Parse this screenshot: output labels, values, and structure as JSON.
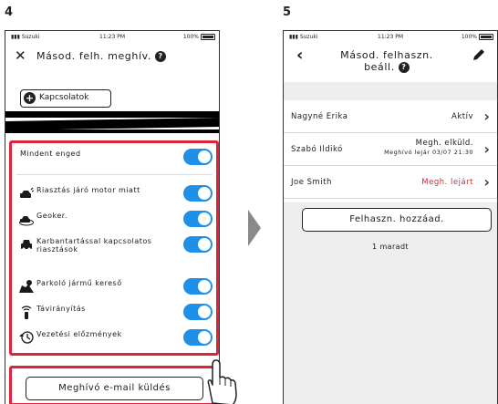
{
  "steps": {
    "left": "4",
    "right": "5"
  },
  "status_bar": {
    "carrier": "Suzuki",
    "time": "11:23 PM",
    "battery": "100%"
  },
  "screen_invite": {
    "title": "Másod. felh. meghív.",
    "help_symbol": "?",
    "contacts_button": "Kapcsolatok",
    "permissions": [
      {
        "label": "Mindent enged",
        "icon": "",
        "enabled": true
      },
      {
        "label": "Riasztás járó motor miatt",
        "icon": "car-alarm-icon",
        "enabled": true
      },
      {
        "label": "Geoker.",
        "icon": "car-fence-icon",
        "enabled": true
      },
      {
        "label": "Karbantartással kapcsolatos riasztások",
        "icon": "car-service-icon",
        "enabled": true
      },
      {
        "label": "Parkoló jármű kereső",
        "icon": "map-pin-icon",
        "enabled": true
      },
      {
        "label": "Távirányítás",
        "icon": "remote-icon",
        "enabled": true
      },
      {
        "label": "Vezetési előzmények",
        "icon": "history-icon",
        "enabled": true
      }
    ],
    "send_button": "Meghívó e-mail küldés"
  },
  "screen_users": {
    "title": "Másod. felhaszn. beáll.",
    "help_symbol": "?",
    "users": [
      {
        "name": "Nagyné Erika",
        "status": "Aktív",
        "substatus": "",
        "status_color": "#1a1a1a"
      },
      {
        "name": "Szabó Ildikó",
        "status": "Megh. elküld.",
        "substatus": "Meghívó lejár 03/07 21:30",
        "status_color": "#1a1a1a"
      },
      {
        "name": "Joe Smith",
        "status": "Megh. lejárt",
        "substatus": "",
        "status_color": "#e0223a"
      }
    ],
    "add_button": "Felhaszn. hozzáad.",
    "remaining": "1 maradt"
  },
  "colors": {
    "highlight": "#e0223a",
    "toggle_on": "#1e90e8",
    "expired": "#e0223a"
  }
}
